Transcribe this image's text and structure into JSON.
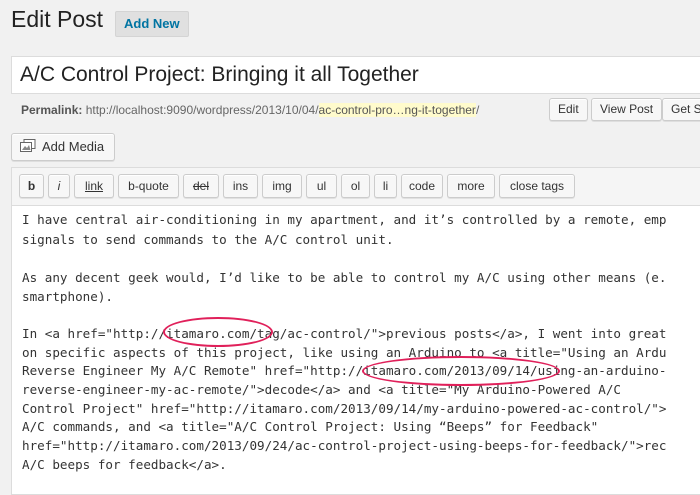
{
  "header": {
    "title": "Edit Post",
    "add_new": "Add New"
  },
  "post": {
    "title": "A/C Control Project: Bringing it all Together"
  },
  "permalink": {
    "label": "Permalink:",
    "base": "http://localhost:9090/wordpress/2013/10/04/",
    "slug": "ac-control-pro…ng-it-together",
    "trail": "/",
    "edit": "Edit",
    "view": "View Post",
    "shortlink": "Get Sh"
  },
  "media": {
    "add_media": "Add Media",
    "icon": "media-icon"
  },
  "quicktags": [
    "b",
    "i",
    "link",
    "b-quote",
    "del",
    "ins",
    "img",
    "ul",
    "ol",
    "li",
    "code",
    "more",
    "close tags"
  ],
  "editor": {
    "lines": [
      "I have central air-conditioning in my apartment, and it’s controlled by a remote, emp",
      "signals to send commands to the A/C control unit.",
      "",
      "As any decent geek would, I’d like to be able to control my A/C using other means (e.",
      "smartphone).",
      "",
      "In <a href=\"http://itamaro.com/tag/ac-control/\">previous posts</a>, I went into great",
      "on specific aspects of this project, like using an Arduino to <a title=\"Using an Ardu",
      "Reverse Engineer My A/C Remote\" href=\"http://itamaro.com/2013/09/14/using-an-arduino-",
      "reverse-engineer-my-ac-remote/\">decode</a> and <a title=\"My Arduino-Powered A/C",
      "Control Project\" href=\"http://itamaro.com/2013/09/14/my-arduino-powered-ac-control/\">",
      "A/C commands, and <a title=\"A/C Control Project: Using “Beeps” for Feedback\"",
      "href=\"http://itamaro.com/2013/09/24/ac-control-project-using-beeps-for-feedback/\">rec",
      "A/C beeps for feedback</a>."
    ]
  },
  "colors": {
    "link": "#0074a2",
    "highlight": "#fffbcc",
    "annotation": "#e0205a"
  }
}
